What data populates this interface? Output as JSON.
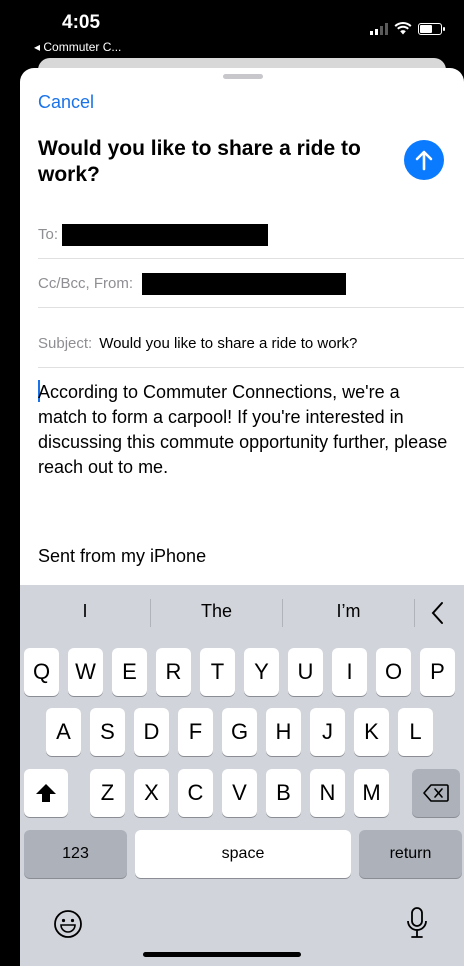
{
  "status_bar": {
    "time": "4:05",
    "back_label": "◂ Commuter C..."
  },
  "compose": {
    "cancel_label": "Cancel",
    "title": "Would you like to share a ride to work?",
    "to_label": "To:",
    "cc_label": "Cc/Bcc, From:",
    "subject_label": "Subject:",
    "subject_value": "Would you like to share a ride to work?",
    "body": "According to Commuter Connections, we're a match to form a carpool! If you're interested in discussing this commute opportunity further, please reach out to me.",
    "signature": "Sent from my iPhone"
  },
  "keyboard": {
    "suggestions": [
      "I",
      "The",
      "I’m"
    ],
    "row1": [
      "Q",
      "W",
      "E",
      "R",
      "T",
      "Y",
      "U",
      "I",
      "O",
      "P"
    ],
    "row2": [
      "A",
      "S",
      "D",
      "F",
      "G",
      "H",
      "J",
      "K",
      "L"
    ],
    "row3": [
      "Z",
      "X",
      "C",
      "V",
      "B",
      "N",
      "M"
    ],
    "numbers_label": "123",
    "space_label": "space",
    "return_label": "return"
  },
  "colors": {
    "accent": "#0a7aff",
    "link": "#1a73e8",
    "keyboard_bg": "#d1d4da"
  }
}
